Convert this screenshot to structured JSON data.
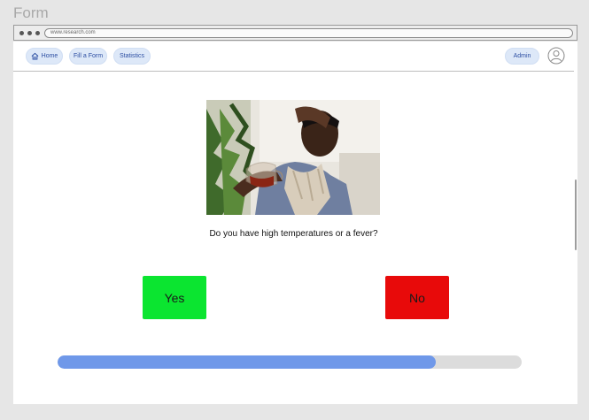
{
  "frame": {
    "title": "Form"
  },
  "browser": {
    "url": "www.research.com"
  },
  "nav": {
    "home_label": "Home",
    "fill_label": "Fill a Form",
    "stats_label": "Statistics",
    "admin_label": "Admin"
  },
  "question": {
    "text": "Do you have high temperatures or a fever?"
  },
  "answers": {
    "yes_label": "Yes",
    "yes_color": "#0be530",
    "no_label": "No",
    "no_color": "#e80a0a"
  },
  "progress": {
    "fraction": 0.815,
    "fill_color": "#6f98e9"
  },
  "icons": {
    "home": "home-icon",
    "avatar": "user-avatar-icon"
  }
}
